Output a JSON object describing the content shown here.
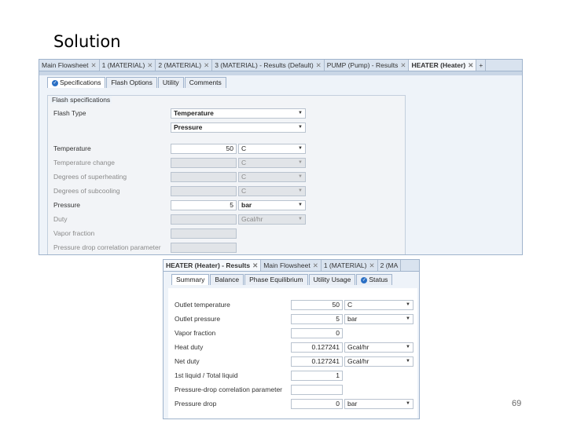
{
  "slide": {
    "title": "Solution",
    "page_number": "69"
  },
  "panel1": {
    "doc_tabs": [
      {
        "label": "Main Flowsheet",
        "active": false
      },
      {
        "label": "1 (MATERIAL)",
        "active": false
      },
      {
        "label": "2 (MATERIAL)",
        "active": false
      },
      {
        "label": "3 (MATERIAL) - Results (Default)",
        "active": false
      },
      {
        "label": "PUMP (Pump) - Results",
        "active": false
      },
      {
        "label": "HEATER (Heater)",
        "active": true
      }
    ],
    "add_tab": "+",
    "sub_tabs": [
      "Specifications",
      "Flash Options",
      "Utility",
      "Comments"
    ],
    "group_label": "Flash specifications",
    "flash_type_label": "Flash Type",
    "flash_type_1": "Temperature",
    "flash_type_2": "Pressure",
    "rows": [
      {
        "label": "Temperature",
        "value": "50",
        "unit": "C",
        "enabled": true
      },
      {
        "label": "Temperature change",
        "value": "",
        "unit": "C",
        "enabled": false
      },
      {
        "label": "Degrees of superheating",
        "value": "",
        "unit": "C",
        "enabled": false
      },
      {
        "label": "Degrees of subcooling",
        "value": "",
        "unit": "C",
        "enabled": false
      },
      {
        "label": "Pressure",
        "value": "5",
        "unit": "bar",
        "enabled": true
      },
      {
        "label": "Duty",
        "value": "",
        "unit": "Gcal/hr",
        "enabled": false
      },
      {
        "label": "Vapor fraction",
        "value": "",
        "unit": "",
        "enabled": false
      },
      {
        "label": "Pressure drop correlation parameter",
        "value": "",
        "unit": "",
        "enabled": false
      }
    ]
  },
  "panel2": {
    "doc_tabs": [
      {
        "label": "HEATER (Heater) - Results",
        "active": true
      },
      {
        "label": "Main Flowsheet",
        "active": false
      },
      {
        "label": "1 (MATERIAL)",
        "active": false
      },
      {
        "label": "2 (MA",
        "active": false
      }
    ],
    "sub_tabs": [
      "Summary",
      "Balance",
      "Phase Equilibrium",
      "Utility Usage",
      "Status"
    ],
    "rows": [
      {
        "label": "Outlet temperature",
        "value": "50",
        "unit": "C"
      },
      {
        "label": "Outlet pressure",
        "value": "5",
        "unit": "bar"
      },
      {
        "label": "Vapor fraction",
        "value": "0",
        "unit": ""
      },
      {
        "label": "Heat duty",
        "value": "0.127241",
        "unit": "Gcal/hr"
      },
      {
        "label": "Net duty",
        "value": "0.127241",
        "unit": "Gcal/hr"
      },
      {
        "label": "1st liquid / Total liquid",
        "value": "1",
        "unit": ""
      },
      {
        "label": "Pressure-drop correlation parameter",
        "value": "",
        "unit": ""
      },
      {
        "label": "Pressure drop",
        "value": "0",
        "unit": "bar"
      }
    ]
  }
}
